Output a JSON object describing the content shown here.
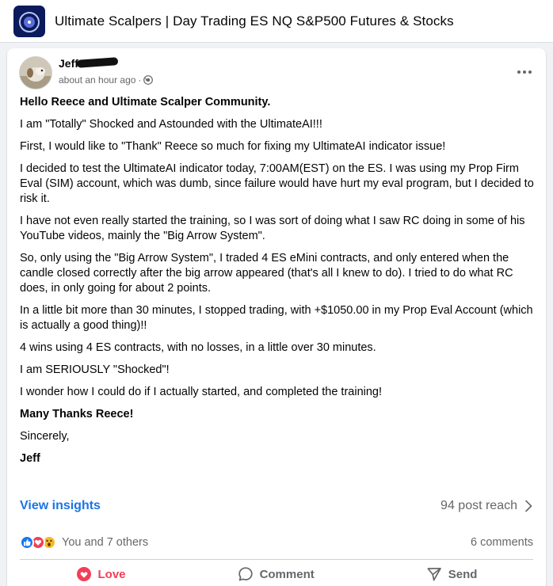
{
  "group": {
    "title": "Ultimate Scalpers | Day Trading ES NQ S&P500 Futures & Stocks",
    "logo_icon": "group-logo-icon"
  },
  "post": {
    "author": "Jeff",
    "timestamp": "about an hour ago",
    "separator": "·",
    "audience_icon": "globe-icon",
    "paragraphs": [
      "Hello Reece and Ultimate Scalper Community.",
      "I am \"Totally\" Shocked and Astounded with the UltimateAI!!!",
      "First, I would like to \"Thank\" Reece so much for fixing my UltimateAI indicator issue!",
      "I decided to test the UltimateAI indicator today, 7:00AM(EST) on the ES. I was using my Prop Firm Eval (SIM) account, which was dumb, since failure would have hurt my eval program, but I decided to risk it.",
      "I have not even really started the training, so I was sort of doing what I saw RC doing in some of his YouTube videos, mainly the \"Big Arrow System\".",
      "So, only using the \"Big Arrow System\", I traded 4 ES eMini contracts, and only entered when the candle closed correctly after the big arrow appeared (that's all I knew to do). I tried to do what RC does, in only going for about 2 points.",
      "In a little bit more than 30 minutes, I stopped trading, with +$1050.00 in my Prop Eval Account (which is actually a good thing)!!",
      "4 wins using 4 ES contracts, with no losses, in a little over 30 minutes.",
      "I am SERIOUSLY \"Shocked\"!",
      "I wonder how I could do if I actually started, and completed the training!",
      "Many Thanks Reece!",
      "Sincerely,",
      "Jeff"
    ],
    "insights_label": "View insights",
    "reach_label": "94 post reach",
    "reactions_text": "You and 7 others",
    "comments_label": "6 comments",
    "actions": {
      "love": "Love",
      "comment": "Comment",
      "send": "Send"
    },
    "colors": {
      "link_blue": "#1b74e4",
      "love_red": "#f33e58",
      "like_blue": "#1877f2",
      "wow_yellow": "#f7b928",
      "muted_text": "#65676b"
    }
  }
}
